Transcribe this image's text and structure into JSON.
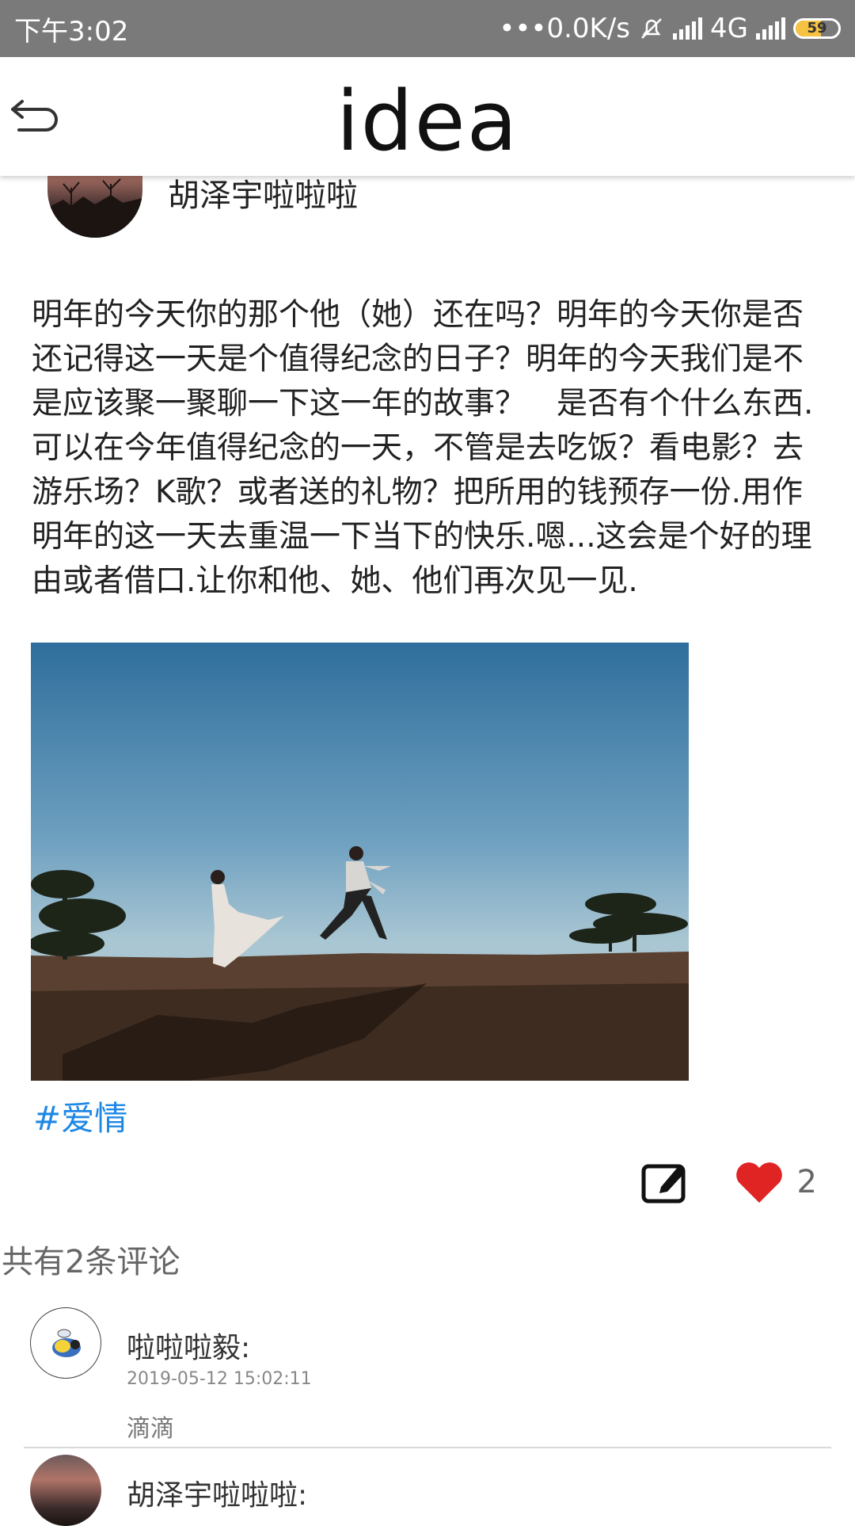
{
  "status_bar": {
    "time": "下午3:02",
    "net_speed": "•••0.0K/s",
    "network": "4G",
    "battery": "59",
    "battery_level": 0.59
  },
  "header": {
    "logo": "idea",
    "back_icon": "back-arrow-icon"
  },
  "post": {
    "author": "胡泽宇啦啦啦",
    "text": "明年的今天你的那个他（她）还在吗？明年的今天你是否还记得这一天是个值得纪念的日子？明年的今天我们是不是应该聚一聚聊一下这一年的故事？　是否有个什么东西.可以在今年值得纪念的一天，不管是去吃饭？看电影？去游乐场？K歌？或者送的礼物？把所用的钱预存一份.用作明年的这一天去重温一下当下的快乐.嗯...这会是个好的理由或者借口.让你和他、她、他们再次见一见.",
    "tag": "#爱情",
    "like_count": "2"
  },
  "comments": {
    "summary": "共有2条评论",
    "items": [
      {
        "author": "啦啦啦毅:",
        "time": "2019-05-12 15:02:11",
        "text": "滴滴"
      },
      {
        "author": "胡泽宇啦啦啦:"
      }
    ]
  },
  "colors": {
    "status_bar": "#7a7a7a",
    "tag": "#1e88e5",
    "heart": "#e02424"
  }
}
